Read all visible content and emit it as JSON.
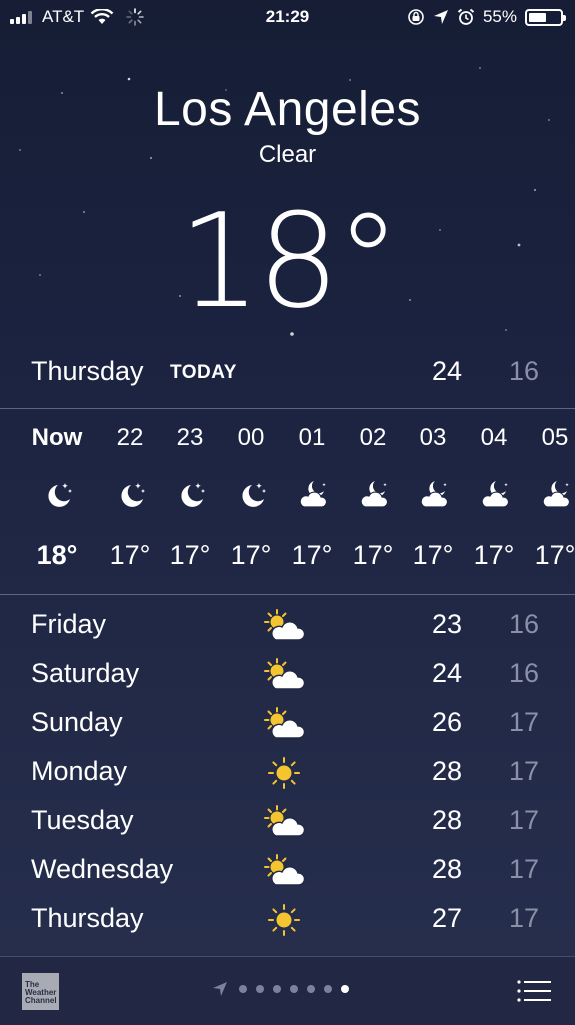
{
  "status_bar": {
    "carrier": "AT&T",
    "time": "21:29",
    "battery": "55%",
    "battery_level": 0.55,
    "icons": [
      "signal-icon",
      "wifi-icon",
      "activity-spinner-icon",
      "rotation-lock-icon",
      "location-arrow-icon",
      "alarm-icon",
      "battery-icon"
    ]
  },
  "location": {
    "city": "Los Angeles",
    "condition": "Clear",
    "temperature": "18°"
  },
  "today": {
    "day": "Thursday",
    "tag": "TODAY",
    "high": "24",
    "low": "16"
  },
  "hourly": [
    {
      "hour": "Now",
      "icon": "moon-stars-icon",
      "temp": "18°"
    },
    {
      "hour": "22",
      "icon": "moon-stars-icon",
      "temp": "17°"
    },
    {
      "hour": "23",
      "icon": "moon-stars-icon",
      "temp": "17°"
    },
    {
      "hour": "00",
      "icon": "moon-stars-icon",
      "temp": "17°"
    },
    {
      "hour": "01",
      "icon": "cloud-moon-icon",
      "temp": "17°"
    },
    {
      "hour": "02",
      "icon": "cloud-moon-icon",
      "temp": "17°"
    },
    {
      "hour": "03",
      "icon": "cloud-moon-icon",
      "temp": "17°"
    },
    {
      "hour": "04",
      "icon": "cloud-moon-icon",
      "temp": "17°"
    },
    {
      "hour": "05",
      "icon": "cloud-moon-icon",
      "temp": "17°"
    }
  ],
  "daily": [
    {
      "day": "Friday",
      "icon": "partly-sunny-icon",
      "high": "23",
      "low": "16"
    },
    {
      "day": "Saturday",
      "icon": "partly-sunny-icon",
      "high": "24",
      "low": "16"
    },
    {
      "day": "Sunday",
      "icon": "partly-sunny-icon",
      "high": "26",
      "low": "17"
    },
    {
      "day": "Monday",
      "icon": "sun-icon",
      "high": "28",
      "low": "17"
    },
    {
      "day": "Tuesday",
      "icon": "partly-sunny-icon",
      "high": "28",
      "low": "17"
    },
    {
      "day": "Wednesday",
      "icon": "partly-sunny-icon",
      "high": "28",
      "low": "17"
    },
    {
      "day": "Thursday",
      "icon": "sun-icon",
      "high": "27",
      "low": "17"
    }
  ],
  "toolbar": {
    "logo_text": "The Weather Channel",
    "page_count": 7,
    "active_page": 7
  },
  "colors": {
    "background": "#1b2340",
    "low_temp": "#8b90a6",
    "sun": "#f5c531"
  }
}
